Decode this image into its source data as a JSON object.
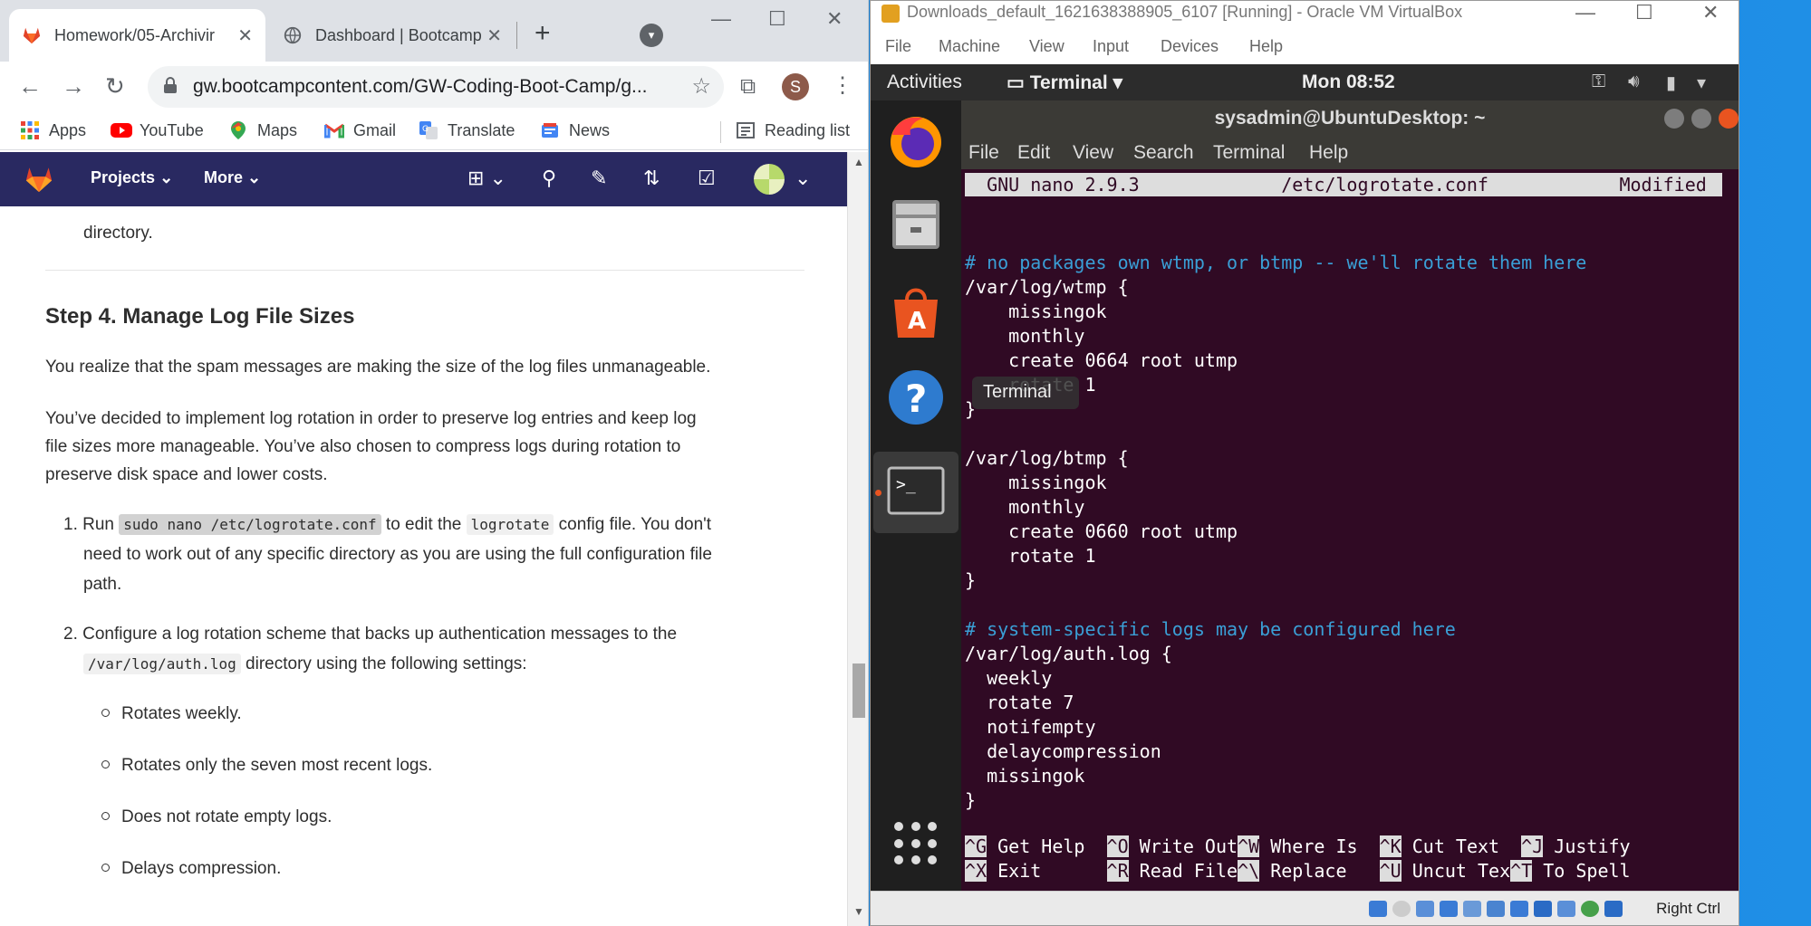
{
  "chrome": {
    "tabs": [
      {
        "label": "Homework/05-Archivir",
        "active": true
      },
      {
        "label": "Dashboard | Bootcamp",
        "active": false
      }
    ],
    "url": "gw.bootcampcontent.com/GW-Coding-Boot-Camp/g...",
    "profile_initial": "S",
    "bookmarks": [
      "Apps",
      "YouTube",
      "Maps",
      "Gmail",
      "Translate",
      "News"
    ],
    "reading_list": "Reading list"
  },
  "gitlab": {
    "nav": [
      "Projects",
      "More"
    ]
  },
  "doc": {
    "top_fragment": "directory.",
    "heading": "Step 4. Manage Log File Sizes",
    "para1": "You realize that the spam messages are making the size of the log files unmanageable.",
    "para2_l1": "You’ve decided to implement log rotation in order to preserve log entries and keep log",
    "para2_l2": "file sizes more manageable. You’ve also chosen to compress logs during rotation to",
    "para2_l3": "preserve disk space and lower costs.",
    "step1_num": "1.",
    "step1_run": "Run",
    "step1_code": "sudo nano /etc/logrotate.conf",
    "step1_mid": "to edit the",
    "step1_code2": "logrotate",
    "step1_end": "config file. You don't",
    "step1_l2": "need to work out of any specific directory as you are using the full configuration file",
    "step1_l3": "path.",
    "step2_num": "2.",
    "step2_l1": "Configure a log rotation scheme that backs up authentication messages to the",
    "step2_code": "/var/log/auth.log",
    "step2_end": "directory using the following settings:",
    "bullets": [
      "Rotates weekly.",
      "Rotates only the seven most recent logs.",
      "Does not rotate empty logs.",
      "Delays compression."
    ]
  },
  "vbox": {
    "title": "Downloads_default_1621638388905_6107 [Running] - Oracle VM VirtualBox",
    "menu": [
      "File",
      "Machine",
      "View",
      "Input",
      "Devices",
      "Help"
    ],
    "host_key": "Right Ctrl"
  },
  "ubuntu": {
    "activities": "Activities",
    "app": "Terminal",
    "clock": "Mon 08:52",
    "dock_tooltip": "Terminal"
  },
  "terminal": {
    "title": "sysadmin@UbuntuDesktop: ~",
    "menu": [
      "File",
      "Edit",
      "View",
      "Search",
      "Terminal",
      "Help"
    ],
    "nano_header": "  GNU nano 2.9.3             /etc/logrotate.conf            Modified  ",
    "lines": [
      "",
      "",
      "# no packages own wtmp, or btmp -- we'll rotate them here",
      "/var/log/wtmp {",
      "    missingok",
      "    monthly",
      "    create 0664 root utmp",
      "    rotate 1",
      "}",
      "",
      "/var/log/btmp {",
      "    missingok",
      "    monthly",
      "    create 0660 root utmp",
      "    rotate 1",
      "}",
      "",
      "# system-specific logs may be configured here",
      "/var/log/auth.log {",
      "  weekly",
      "  rotate 7",
      "  notifempty",
      "  delaycompression",
      "  missingok",
      "}"
    ],
    "shortcuts_row1": [
      {
        "key": "^G",
        "label": " Get Help  "
      },
      {
        "key": "^O",
        "label": " Write Out"
      },
      {
        "key": "^W",
        "label": " Where Is  "
      },
      {
        "key": "^K",
        "label": " Cut Text  "
      },
      {
        "key": "^J",
        "label": " Justify"
      }
    ],
    "shortcuts_row2": [
      {
        "key": "^X",
        "label": " Exit      "
      },
      {
        "key": "^R",
        "label": " Read File"
      },
      {
        "key": "^\\",
        "label": " Replace   "
      },
      {
        "key": "^U",
        "label": " Uncut Tex"
      },
      {
        "key": "^T",
        "label": " To Spell"
      }
    ]
  },
  "colors": {
    "gitlab_nav": "#292961",
    "terminal_bg": "#300a24",
    "comment": "#3a9fd6",
    "ubuntu_orange": "#e95420"
  }
}
